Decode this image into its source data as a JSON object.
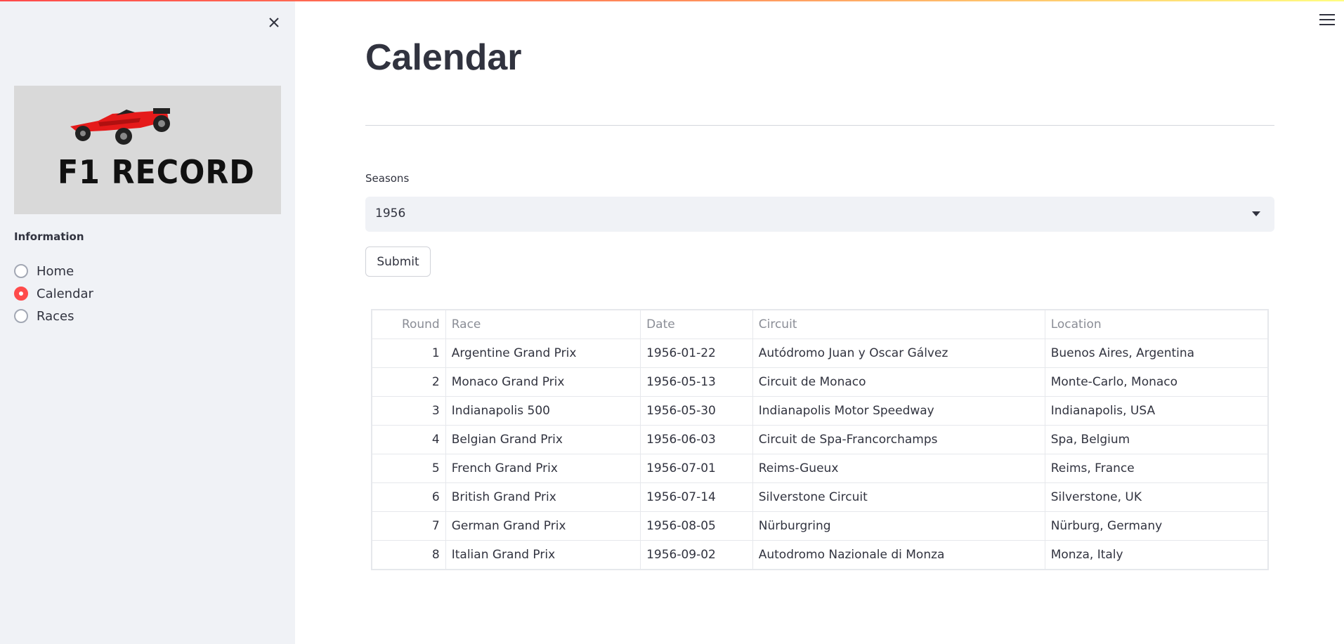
{
  "sidebar": {
    "logo_text": "F1 RECORD",
    "radio_title": "Information",
    "items": [
      {
        "label": "Home",
        "selected": false
      },
      {
        "label": "Calendar",
        "selected": true
      },
      {
        "label": "Races",
        "selected": false
      }
    ]
  },
  "main": {
    "title": "Calendar",
    "select_label": "Seasons",
    "select_value": "1956",
    "submit_label": "Submit"
  },
  "table": {
    "headers": [
      "Round",
      "Race",
      "Date",
      "Circuit",
      "Location"
    ],
    "rows": [
      [
        "1",
        "Argentine Grand Prix",
        "1956-01-22",
        "Autódromo Juan y Oscar Gálvez",
        "Buenos Aires, Argentina"
      ],
      [
        "2",
        "Monaco Grand Prix",
        "1956-05-13",
        "Circuit de Monaco",
        "Monte-Carlo, Monaco"
      ],
      [
        "3",
        "Indianapolis 500",
        "1956-05-30",
        "Indianapolis Motor Speedway",
        "Indianapolis, USA"
      ],
      [
        "4",
        "Belgian Grand Prix",
        "1956-06-03",
        "Circuit de Spa-Francorchamps",
        "Spa, Belgium"
      ],
      [
        "5",
        "French Grand Prix",
        "1956-07-01",
        "Reims-Gueux",
        "Reims, France"
      ],
      [
        "6",
        "British Grand Prix",
        "1956-07-14",
        "Silverstone Circuit",
        "Silverstone, UK"
      ],
      [
        "7",
        "German Grand Prix",
        "1956-08-05",
        "Nürburgring",
        "Nürburg, Germany"
      ],
      [
        "8",
        "Italian Grand Prix",
        "1956-09-02",
        "Autodromo Nazionale di Monza",
        "Monza, Italy"
      ]
    ]
  },
  "icons": {
    "close": "close-icon",
    "menu": "hamburger-menu-icon",
    "dropdown": "chevron-down-icon"
  },
  "colors": {
    "accent": "#ff4b4b",
    "sidebar_bg": "#f0f2f6",
    "text": "#31333f"
  }
}
